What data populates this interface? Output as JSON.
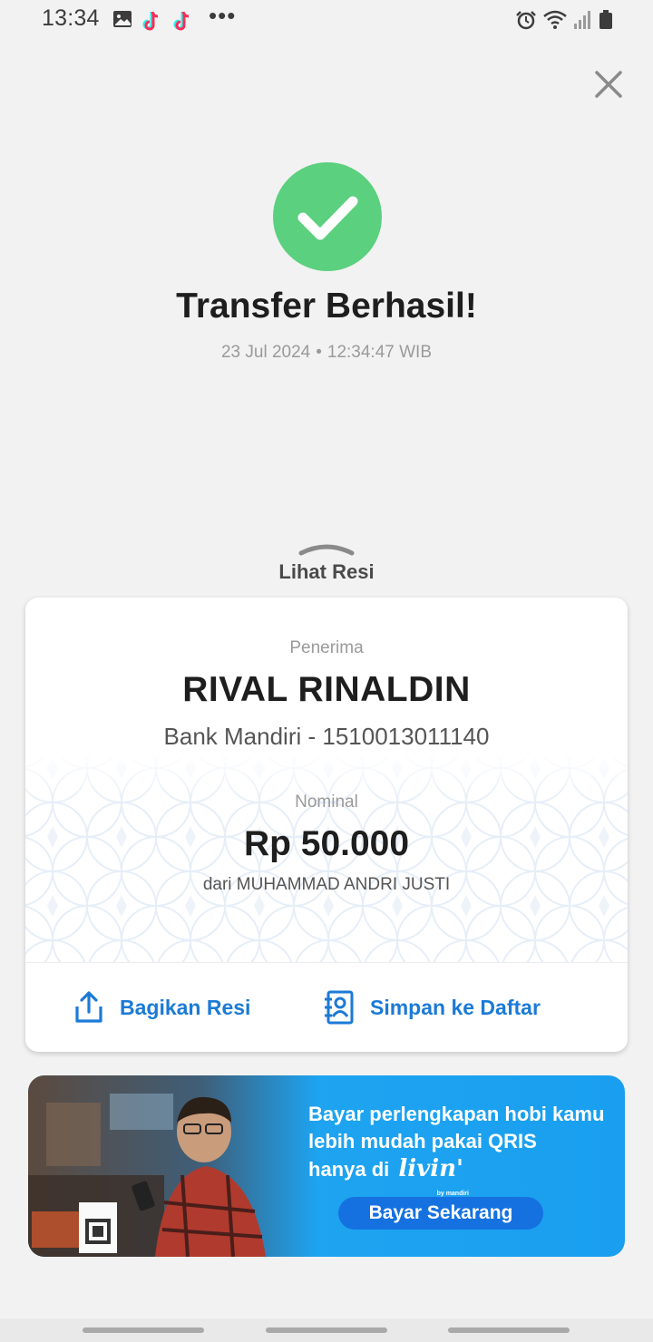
{
  "status_bar": {
    "time": "13:34",
    "dots": "•••",
    "icons": [
      "gallery-icon",
      "tiktok-icon",
      "tiktok-icon",
      "alarm-icon",
      "wifi-icon",
      "signal-icon",
      "battery-icon"
    ]
  },
  "close_icon": "close-icon",
  "success": {
    "icon": "check-icon",
    "title": "Transfer Berhasil!",
    "date": "23 Jul 2024",
    "separator": "•",
    "time": "12:34:47 WIB"
  },
  "receipt": {
    "toggle_label": "Lihat Resi",
    "recipient_label": "Penerima",
    "recipient_name": "RIVAL RINALDIN",
    "bank_account": "Bank Mandiri - 1510013011140",
    "amount_label": "Nominal",
    "amount": "Rp 50.000",
    "sender": "dari MUHAMMAD ANDRI JUSTI"
  },
  "actions": {
    "share_label": "Bagikan Resi",
    "save_label": "Simpan ke Daftar"
  },
  "promo": {
    "line1": "Bayar perlengkapan hobi kamu",
    "line2": "lebih mudah pakai QRIS",
    "line3": "hanya di",
    "brand": "livin'",
    "brand_sub": "by mandiri",
    "button_label": "Bayar Sekarang"
  },
  "colors": {
    "success_green": "#5bd07e",
    "action_blue": "#1b7ad6",
    "banner_blue": "#1da3f0",
    "button_blue": "#1571e0"
  }
}
